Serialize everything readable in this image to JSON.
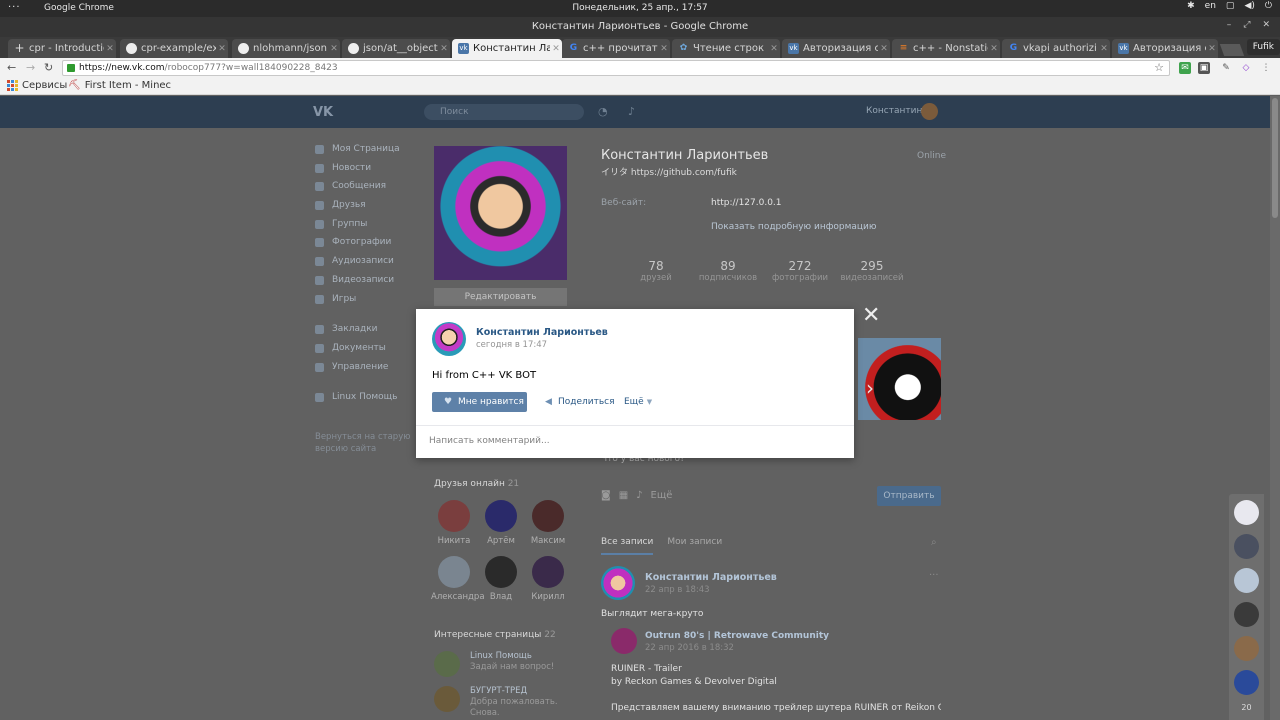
{
  "system": {
    "apps_label": "···",
    "app_name": "Google Chrome",
    "clock": "Понедельник, 25 апр., 17:57",
    "lang": "en"
  },
  "window": {
    "title": "Константин Ларионтьев - Google Chrome",
    "profile": "Fufik"
  },
  "tabs": [
    {
      "label": "cpr - Introductio",
      "icon": "plus-icon"
    },
    {
      "label": "cpr-example/ex",
      "icon": "github-icon"
    },
    {
      "label": "nlohmann/json",
      "icon": "github-icon"
    },
    {
      "label": "json/at__object",
      "icon": "github-icon"
    },
    {
      "label": "Константин Ла",
      "icon": "vk-icon"
    },
    {
      "label": "c++ прочитать",
      "icon": "google-icon"
    },
    {
      "label": "Чтение строк и",
      "icon": "habr-icon"
    },
    {
      "label": "Авторизация с",
      "icon": "vk-icon"
    },
    {
      "label": "c++ - Nonstatic",
      "icon": "stackoverflow-icon"
    },
    {
      "label": "vkapi authorizi",
      "icon": "google-icon"
    },
    {
      "label": "Авторизация с",
      "icon": "vk-icon"
    }
  ],
  "address": {
    "scheme_host": "https://new.vk.com",
    "path": "/robocop777?w=wall184090228_8423"
  },
  "bookmarks": [
    {
      "label": "Сервисы"
    },
    {
      "label": "First Item - Minec"
    }
  ],
  "vk_header": {
    "logo": "VK",
    "search_placeholder": "Поиск",
    "user": "Константин"
  },
  "menu": {
    "items": [
      "Моя Страница",
      "Новости",
      "Сообщения",
      "Друзья",
      "Группы",
      "Фотографии",
      "Аудиозаписи",
      "Видеозаписи",
      "Игры"
    ],
    "items2": [
      "Закладки",
      "Документы",
      "Управление"
    ],
    "items3": [
      "Linux Помощь"
    ],
    "old_version": "Вернуться на старую версию сайта"
  },
  "profile": {
    "edit": "Редактировать",
    "name": "Константин Ларионтьев",
    "status": "イリタ https://github.com/fufik",
    "online": "Online",
    "site_label": "Веб-сайт:",
    "site": "http://127.0.0.1",
    "show_more": "Показать подробную информацию",
    "stats": [
      {
        "n": "78",
        "l": "друзей"
      },
      {
        "n": "89",
        "l": "подписчиков"
      },
      {
        "n": "272",
        "l": "фотографии"
      },
      {
        "n": "295",
        "l": "видеозаписей"
      }
    ]
  },
  "composer": {
    "hint": "Что у вас нового?",
    "more": "Ещё",
    "send": "Отправить"
  },
  "friends_online": {
    "title": "Друзья онлайн",
    "count": "21",
    "list": [
      "Никита",
      "Артём",
      "Максим",
      "Александра",
      "Влад",
      "Кирилл"
    ]
  },
  "interesting": {
    "title": "Интересные страницы",
    "count": "22",
    "items": [
      {
        "title": "Linux Помощь",
        "sub": "Задай нам вопрос!"
      },
      {
        "title": "БУГУРТ-ТРЕД",
        "sub": "Добра пожаловать. Снова."
      }
    ]
  },
  "wall": {
    "tab_all": "Все записи",
    "tab_mine": "Мои записи",
    "post_author": "Константин Ларионтьев",
    "post_date": "22 апр в 18:43",
    "post_text": "Выглядит мега-круто",
    "repost_author": "Outrun 80's | Retrowave Community",
    "repost_date": "22 апр 2016 в 18:32",
    "repost_lines": [
      "RUINER - Trailer",
      "by Reckon Games & Devolver Digital",
      "",
      "Представляем вашему вниманию трейлер шутера RUINER от Reikon Games и"
    ]
  },
  "chat": {
    "count": "20"
  },
  "modal": {
    "author": "Константин Ларионтьев",
    "date": "сегодня в 17:47",
    "text": "Hi from C++ VK BOT",
    "like": "Мне нравится",
    "share": "Поделиться",
    "more": "Ещё",
    "comment_placeholder": "Написать комментарий..."
  },
  "colors": {
    "vk_blue": "#5e81a8",
    "vk_link": "#2a5885"
  }
}
